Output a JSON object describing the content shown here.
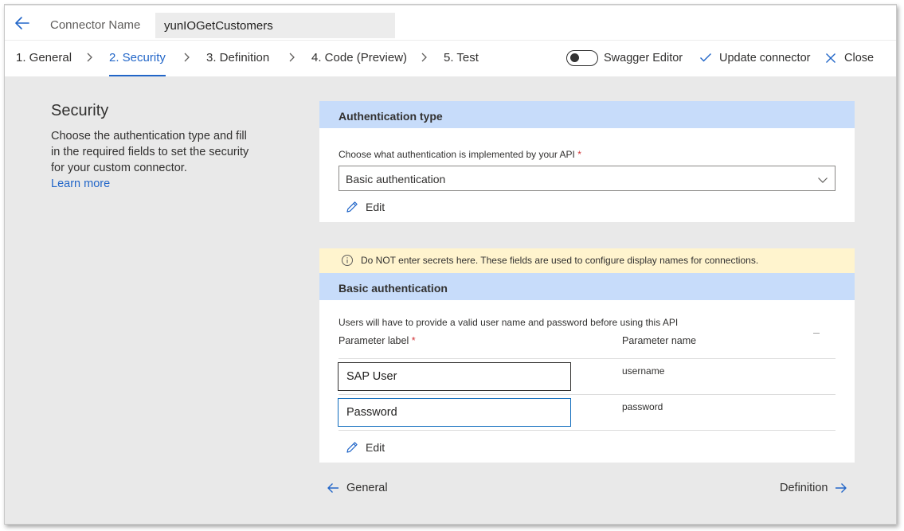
{
  "header": {
    "connector_label": "Connector Name",
    "connector_value": "yunIOGetCustomers"
  },
  "tabs": [
    {
      "label": "1. General",
      "active": false
    },
    {
      "label": "2. Security",
      "active": true
    },
    {
      "label": "3. Definition",
      "active": false
    },
    {
      "label": "4. Code (Preview)",
      "active": false
    },
    {
      "label": "5. Test",
      "active": false
    }
  ],
  "toolbar": {
    "swagger_label": "Swagger Editor",
    "swagger_on": false,
    "update_label": "Update connector",
    "close_label": "Close"
  },
  "left": {
    "title": "Security",
    "description": "Choose the authentication type and fill in the required fields to set the security for your custom connector.",
    "learn_more": "Learn more"
  },
  "auth_type": {
    "heading": "Authentication type",
    "question": "Choose what authentication is implemented by your API",
    "required_mark": "*",
    "selected": "Basic authentication",
    "edit_label": "Edit"
  },
  "warning": {
    "text": "Do NOT enter secrets here. These fields are used to configure display names for connections."
  },
  "basic_auth": {
    "heading": "Basic authentication",
    "description": "Users will have to provide a valid user name and password before using this API",
    "col_label": "Parameter label",
    "col_label_required": "*",
    "col_name": "Parameter name",
    "params": [
      {
        "label": "SAP User",
        "name": "username"
      },
      {
        "label": "Password",
        "name": "password"
      }
    ],
    "edit_label": "Edit"
  },
  "footer_nav": {
    "prev_label": "General",
    "next_label": "Definition"
  },
  "colors": {
    "accent": "#2266c8",
    "panel_header": "#c7dcfa",
    "warning_bg": "#fff4ce",
    "page_bg": "#e9e9e9"
  }
}
